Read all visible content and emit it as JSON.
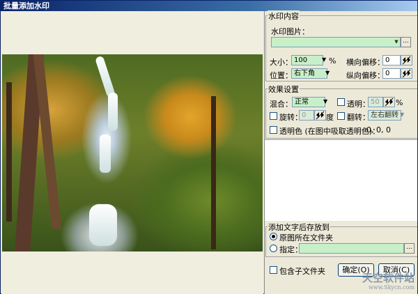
{
  "window": {
    "title": "批量添加水印"
  },
  "watermark_content": {
    "group_label": "水印内容",
    "image_label": "水印图片：",
    "image_value": "",
    "size_label": "大小：",
    "size_value": "100",
    "size_unit": "%",
    "position_label": "位置：",
    "position_value": "右下角",
    "h_offset_label": "横向偏移：",
    "h_offset_value": "0",
    "v_offset_label": "纵向偏移：",
    "v_offset_value": "0",
    "browse_label": "..."
  },
  "effects": {
    "group_label": "效果设置",
    "blend_label": "混合：",
    "blend_value": "正常",
    "transparency_label": "透明：",
    "transparency_value": "50",
    "transparency_unit": "%",
    "rotate_label": "旋转：",
    "rotate_value": "0",
    "rotate_unit": "度",
    "flip_label": "翻转：",
    "flip_value": "左右翻转",
    "transparent_color_label": "透明色 (在图中吸取透明色)：",
    "transparent_color_value": "0, 0, 0"
  },
  "save": {
    "group_label": "添加文字后存放到",
    "original_folder_label": "原图所在文件夹",
    "specify_label": "指定：",
    "specify_value": "",
    "browse_label": "..."
  },
  "subfolders_label": "包含子文件夹",
  "ok_label": "确定(O)",
  "cancel_label": "取消(C)",
  "preview": {
    "credit": ""
  },
  "site_watermark": {
    "main": "天空软件站",
    "sub": "www.Skycn.com"
  },
  "colors": {
    "field_bg": "#c8f0c8",
    "title_start": "#0a246a",
    "title_end": "#a6caf0"
  }
}
